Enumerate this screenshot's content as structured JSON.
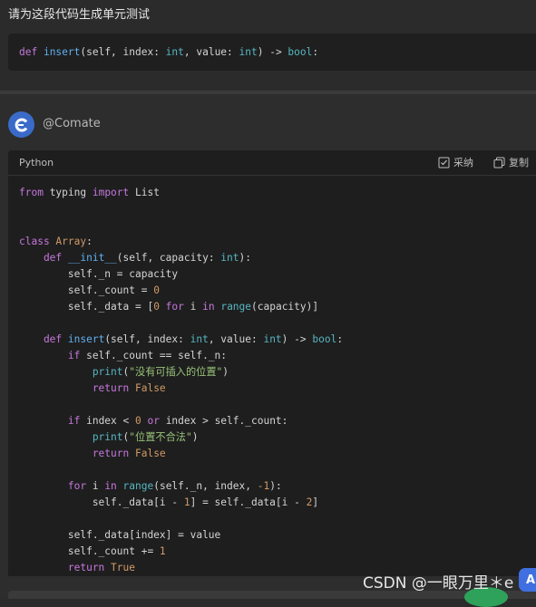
{
  "prompt": {
    "text": "请为这段代码生成单元测试",
    "code_tokens": [
      {
        "t": "def ",
        "c": "kw"
      },
      {
        "t": "insert",
        "c": "fn"
      },
      {
        "t": "(self, index: ",
        "c": "tx"
      },
      {
        "t": "int",
        "c": "bi"
      },
      {
        "t": ", value: ",
        "c": "tx"
      },
      {
        "t": "int",
        "c": "bi"
      },
      {
        "t": ") -> ",
        "c": "tx"
      },
      {
        "t": "bool",
        "c": "bi"
      },
      {
        "t": ":",
        "c": "tx"
      }
    ]
  },
  "answer": {
    "author": "@Comate",
    "language": "Python",
    "adopt_label": "采纳",
    "copy_label": "复制",
    "code_lines": [
      [
        {
          "t": "from ",
          "c": "kw"
        },
        {
          "t": "typing ",
          "c": "tx"
        },
        {
          "t": "import ",
          "c": "kw"
        },
        {
          "t": "List",
          "c": "tx"
        }
      ],
      [],
      [],
      [
        {
          "t": "class ",
          "c": "kw"
        },
        {
          "t": "Array",
          "c": "num"
        },
        {
          "t": ":",
          "c": "tx"
        }
      ],
      [
        {
          "t": "    def ",
          "c": "kw"
        },
        {
          "t": "__init__",
          "c": "fn"
        },
        {
          "t": "(self, capacity: ",
          "c": "tx"
        },
        {
          "t": "int",
          "c": "bi"
        },
        {
          "t": "):",
          "c": "tx"
        }
      ],
      [
        {
          "t": "        self._n = capacity",
          "c": "tx"
        }
      ],
      [
        {
          "t": "        self._count = ",
          "c": "tx"
        },
        {
          "t": "0",
          "c": "num"
        }
      ],
      [
        {
          "t": "        self._data = [",
          "c": "tx"
        },
        {
          "t": "0",
          "c": "num"
        },
        {
          "t": " for ",
          "c": "kw"
        },
        {
          "t": "i ",
          "c": "tx"
        },
        {
          "t": "in ",
          "c": "kw"
        },
        {
          "t": "range",
          "c": "bi"
        },
        {
          "t": "(capacity)]",
          "c": "tx"
        }
      ],
      [],
      [
        {
          "t": "    def ",
          "c": "kw"
        },
        {
          "t": "insert",
          "c": "fn"
        },
        {
          "t": "(self, index: ",
          "c": "tx"
        },
        {
          "t": "int",
          "c": "bi"
        },
        {
          "t": ", value: ",
          "c": "tx"
        },
        {
          "t": "int",
          "c": "bi"
        },
        {
          "t": ") -> ",
          "c": "tx"
        },
        {
          "t": "bool",
          "c": "bi"
        },
        {
          "t": ":",
          "c": "tx"
        }
      ],
      [
        {
          "t": "        if ",
          "c": "kw"
        },
        {
          "t": "self._count == self._n:",
          "c": "tx"
        }
      ],
      [
        {
          "t": "            print",
          "c": "bi"
        },
        {
          "t": "(",
          "c": "tx"
        },
        {
          "t": "\"没有可插入的位置\"",
          "c": "str"
        },
        {
          "t": ")",
          "c": "tx"
        }
      ],
      [
        {
          "t": "            return ",
          "c": "kw"
        },
        {
          "t": "False",
          "c": "num"
        }
      ],
      [],
      [
        {
          "t": "        if ",
          "c": "kw"
        },
        {
          "t": "index < ",
          "c": "tx"
        },
        {
          "t": "0",
          "c": "num"
        },
        {
          "t": " or ",
          "c": "kw"
        },
        {
          "t": "index > self._count:",
          "c": "tx"
        }
      ],
      [
        {
          "t": "            print",
          "c": "bi"
        },
        {
          "t": "(",
          "c": "tx"
        },
        {
          "t": "\"位置不合法\"",
          "c": "str"
        },
        {
          "t": ")",
          "c": "tx"
        }
      ],
      [
        {
          "t": "            return ",
          "c": "kw"
        },
        {
          "t": "False",
          "c": "num"
        }
      ],
      [],
      [
        {
          "t": "        for ",
          "c": "kw"
        },
        {
          "t": "i ",
          "c": "tx"
        },
        {
          "t": "in ",
          "c": "kw"
        },
        {
          "t": "range",
          "c": "bi"
        },
        {
          "t": "(self._n, index, ",
          "c": "tx"
        },
        {
          "t": "-1",
          "c": "num"
        },
        {
          "t": "):",
          "c": "tx"
        }
      ],
      [
        {
          "t": "            self._data[i - ",
          "c": "tx"
        },
        {
          "t": "1",
          "c": "num"
        },
        {
          "t": "] = self._data[i - ",
          "c": "tx"
        },
        {
          "t": "2",
          "c": "num"
        },
        {
          "t": "]",
          "c": "tx"
        }
      ],
      [],
      [
        {
          "t": "        self._data[index] = value",
          "c": "tx"
        }
      ],
      [
        {
          "t": "        self._count += ",
          "c": "tx"
        },
        {
          "t": "1",
          "c": "num"
        }
      ],
      [
        {
          "t": "        return ",
          "c": "kw"
        },
        {
          "t": "True",
          "c": "num"
        }
      ]
    ]
  },
  "watermark": "CSDN @一眼万里＊e",
  "ai_badge": "A",
  "colors": {
    "accent": "#3f6fe0",
    "keyword": "#c678dd",
    "function": "#61afef",
    "builtin": "#56b6c2",
    "number": "#d19a66",
    "string": "#98c379"
  },
  "icons": [
    "comate-logo-icon",
    "adopt-check-icon",
    "copy-icon"
  ]
}
